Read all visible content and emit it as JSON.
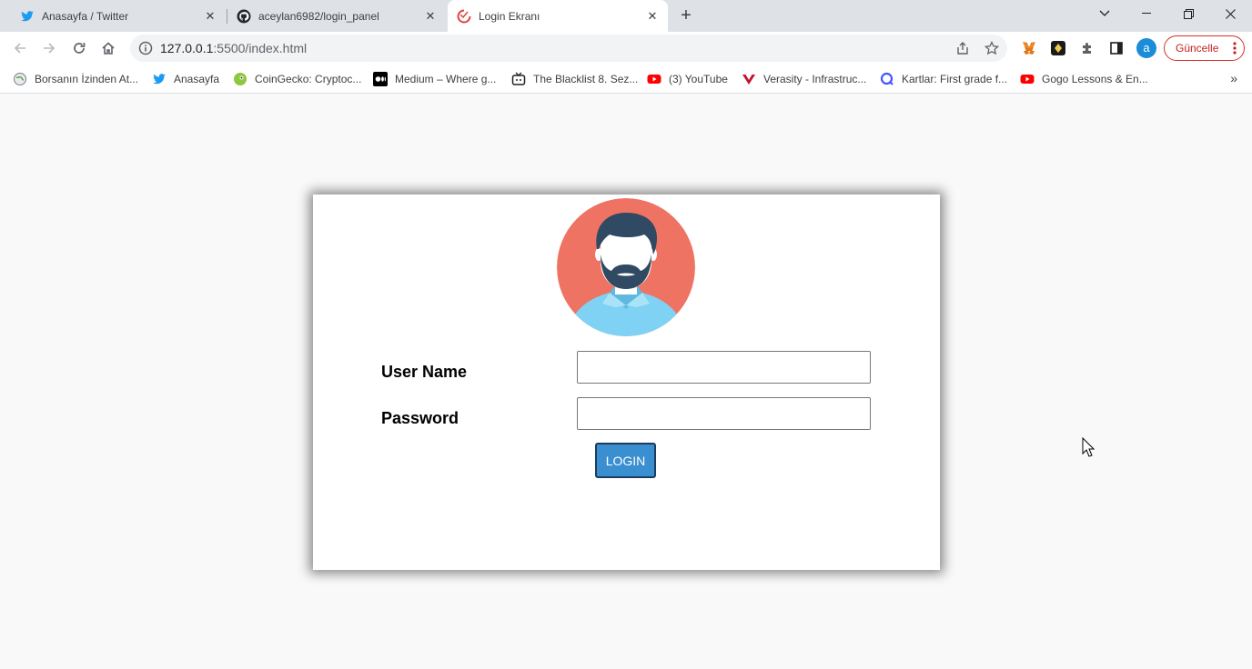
{
  "tabs": [
    {
      "title": "Anasayfa / Twitter",
      "icon": "twitter-icon"
    },
    {
      "title": "aceylan6982/login_panel",
      "icon": "github-icon"
    },
    {
      "title": "Login Ekranı",
      "icon": "page-favicon-icon",
      "active": true
    }
  ],
  "address_bar": {
    "host": "127.0.0.1",
    "path": ":5500/index.html"
  },
  "toolbar": {
    "profile_initial": "a",
    "update_label": "Güncelle"
  },
  "bookmarks": [
    {
      "label": "Borsanın İzinden At...",
      "icon": "globe-icon"
    },
    {
      "label": "Anasayfa",
      "icon": "twitter-icon"
    },
    {
      "label": "CoinGecko: Cryptoc...",
      "icon": "coingecko-icon"
    },
    {
      "label": "Medium – Where g...",
      "icon": "medium-icon"
    },
    {
      "label": "The Blacklist 8. Sez...",
      "icon": "tv-icon"
    },
    {
      "label": "(3) YouTube",
      "icon": "youtube-icon"
    },
    {
      "label": "Verasity - Infrastruc...",
      "icon": "verasity-icon"
    },
    {
      "label": "Kartlar: First grade f...",
      "icon": "quizlet-icon"
    },
    {
      "label": "Gogo Lessons & En...",
      "icon": "youtube-icon"
    }
  ],
  "bookmarks_more": "»",
  "login_form": {
    "username_label": "User Name",
    "username_value": "",
    "password_label": "Password",
    "password_value": "",
    "login_button": "LOGIN"
  },
  "colors": {
    "avatar_background": "#ef7363",
    "shirt": "#7fd2f3",
    "hair": "#2f4a62",
    "button": "#3a8fd0"
  }
}
